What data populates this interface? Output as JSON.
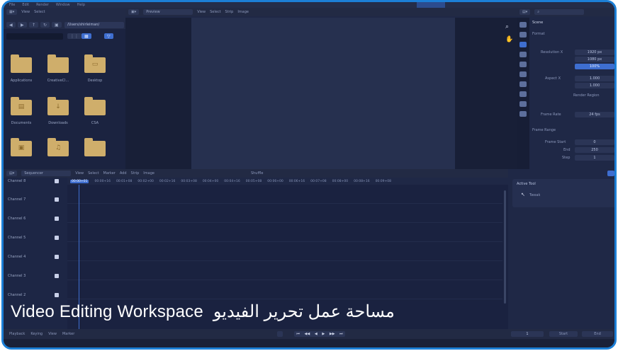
{
  "topbar": {
    "menu": [
      "File",
      "Edit",
      "Render",
      "Window",
      "Help"
    ]
  },
  "file_browser": {
    "header_items": [
      "View",
      "Select"
    ],
    "path": "/Users/shirleiman/",
    "folders": [
      {
        "label": "Applications",
        "icon": "folder-icon"
      },
      {
        "label": "CreativeCl...",
        "icon": "folder-icon"
      },
      {
        "label": "Desktop",
        "icon": "folder-desktop-icon"
      },
      {
        "label": "Documents",
        "icon": "folder-documents-icon"
      },
      {
        "label": "Downloads",
        "icon": "folder-downloads-icon"
      },
      {
        "label": "CSA",
        "icon": "folder-icon"
      },
      {
        "label": "",
        "icon": "folder-photos-icon"
      },
      {
        "label": "",
        "icon": "folder-music-icon"
      },
      {
        "label": "",
        "icon": "folder-icon"
      }
    ]
  },
  "preview": {
    "mode": "Preview",
    "menu": [
      "View",
      "Select",
      "Strip",
      "Image"
    ]
  },
  "properties": {
    "scene_label": "Scene",
    "format_label": "Format",
    "resolution_label": "Resolution X",
    "res_x": "1920 px",
    "res_y": "1080 px",
    "res_pct": "100%",
    "aspect_label": "Aspect X",
    "aspect_x": "1.000",
    "aspect_y": "1.000",
    "render_region": "Render Region",
    "frame_rate_label": "Frame Rate",
    "frame_rate": "24 fps",
    "frame_range_label": "Frame Range",
    "frame_start_label": "Frame Start",
    "frame_start": "0",
    "end_label": "End",
    "end": "250",
    "step_label": "Step",
    "step": "1"
  },
  "sequencer": {
    "mode": "Sequencer",
    "menu": [
      "View",
      "Select",
      "Marker",
      "Add",
      "Strip",
      "Image"
    ],
    "shuffle": "Shuffle",
    "current_time": "00:00+01",
    "ruler": [
      "00:00+16",
      "00:01+08",
      "00:02+00",
      "00:02+16",
      "00:03+08",
      "00:04+00",
      "00:04+16",
      "00:05+08",
      "00:06+00",
      "00:06+16",
      "00:07+08",
      "00:08+00",
      "00:08+16",
      "00:09+08"
    ],
    "channels": [
      "Channel 8",
      "Channel 7",
      "Channel 6",
      "Channel 5",
      "Channel 4",
      "Channel 3",
      "Channel 2"
    ]
  },
  "tool_panel": {
    "title": "Active Tool",
    "tool": "Tweak"
  },
  "playback": {
    "items": [
      "Playback",
      "Keying",
      "View",
      "Marker"
    ],
    "start_label": "Start",
    "end_label": "End",
    "current": "1"
  },
  "caption": {
    "english": "Video Editing Workspace",
    "arabic": "مساحة عمل تحرير الفيديو"
  },
  "colors": {
    "accent": "#3e6ed0",
    "frame_border": "#1c7fd6",
    "folder": "#cfae6b"
  }
}
